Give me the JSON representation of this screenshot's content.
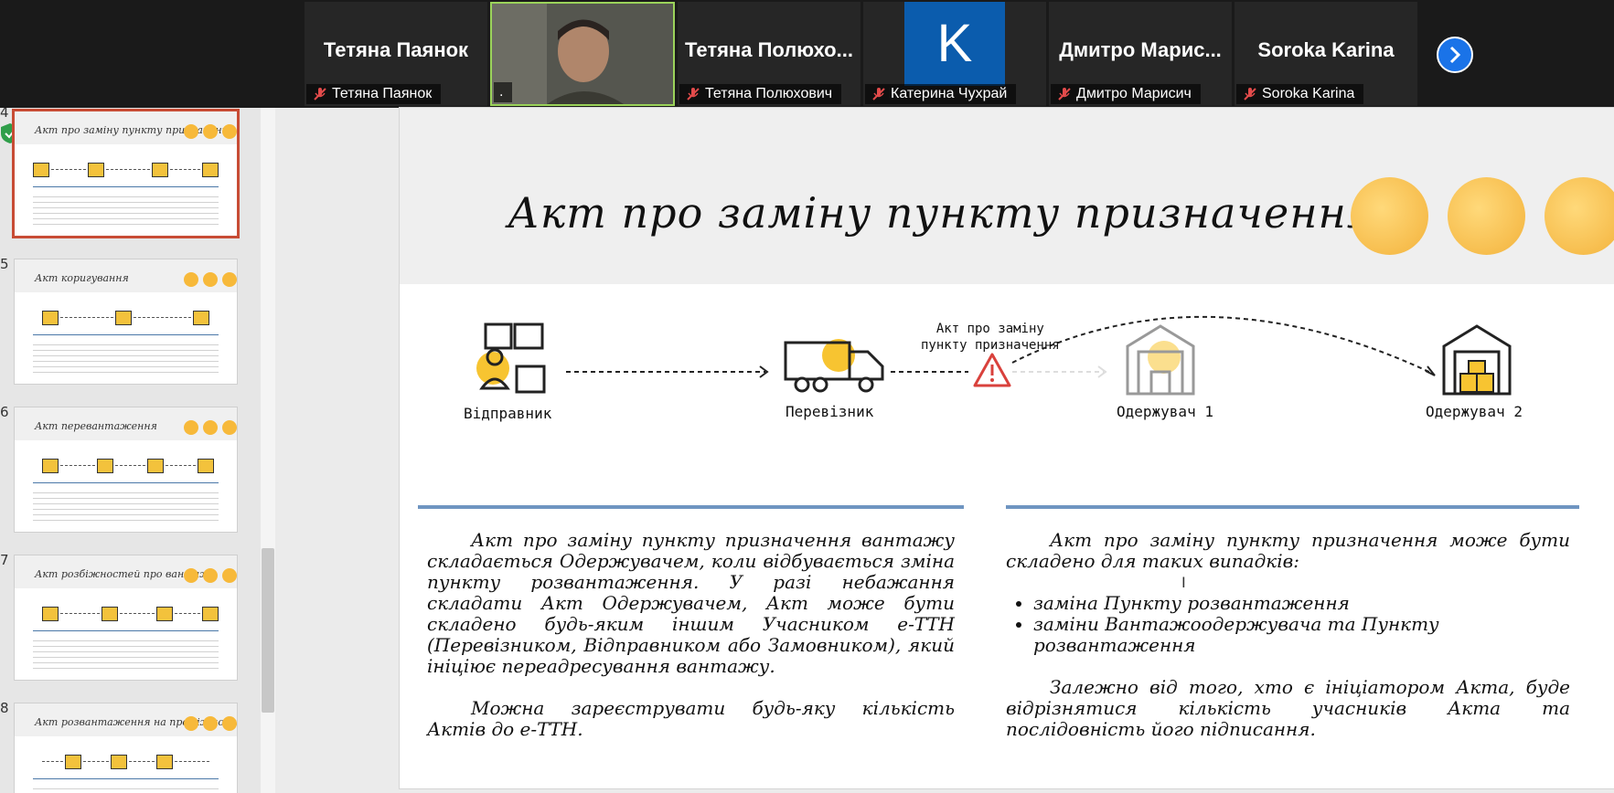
{
  "participants": [
    {
      "display_name": "Тетяна Паянок",
      "label": "Тетяна Паянок",
      "type": "name"
    },
    {
      "display_name": "",
      "label": ".",
      "type": "video"
    },
    {
      "display_name": "Тетяна Полюхо...",
      "label": "Тетяна Полюхович",
      "type": "name"
    },
    {
      "display_name": "K",
      "label": "Катерина Чухрай",
      "type": "letter"
    },
    {
      "display_name": "Дмитро Марис...",
      "label": "Дмитро Марисич",
      "type": "name"
    },
    {
      "display_name": "Soroka Karina",
      "label": "Soroka Karina",
      "type": "name"
    }
  ],
  "thumbnails": [
    {
      "number": "4",
      "title": "Акт про заміну пункту призначення",
      "active": true
    },
    {
      "number": "5",
      "title": "Акт коригування",
      "active": false
    },
    {
      "number": "6",
      "title": "Акт перевантаження",
      "active": false
    },
    {
      "number": "7",
      "title": "Акт розбіжностей про вантаж",
      "active": false
    },
    {
      "number": "8",
      "title": "Акт розвантаження на проміжному складі",
      "active": false
    }
  ],
  "slide": {
    "title": "Акт про заміну пункту призначення",
    "callout": [
      "Акт про заміну",
      "пункту призначення"
    ],
    "nodes": {
      "sender": "Відправник",
      "carrier": "Перевізник",
      "receiver1": "Одержувач 1",
      "receiver2": "Одержувач 2"
    },
    "left_text": {
      "p1": "Акт про заміну пункту призначення вантажу складається Одержувачем, коли відбувається зміна пункту розвантаження. У разі небажання складати Акт Одержувачем, Акт може бути складено будь-яким іншим Учасником е-ТТН (Перевізником, Відправником або Замовником), який ініціює переадресування вантажу.",
      "p2": "Можна зареєструвати будь-яку кількість Актів до е-ТТН."
    },
    "right_text": {
      "p1": "Акт про заміну пункту призначення може бути складено для таких випадків:",
      "bullets": [
        "заміна Пункту розвантаження",
        "заміни Вантажоодержувача та Пункту розвантаження"
      ],
      "p2": "Залежно від того, хто є ініціатором Акта, буде відрізнятися кількість учасників Акта та послідовність його підписання."
    }
  },
  "colors": {
    "accent": "#f7b93a",
    "rule": "#6f95c1",
    "warning": "#d9413c",
    "active_border": "#c84c35"
  }
}
